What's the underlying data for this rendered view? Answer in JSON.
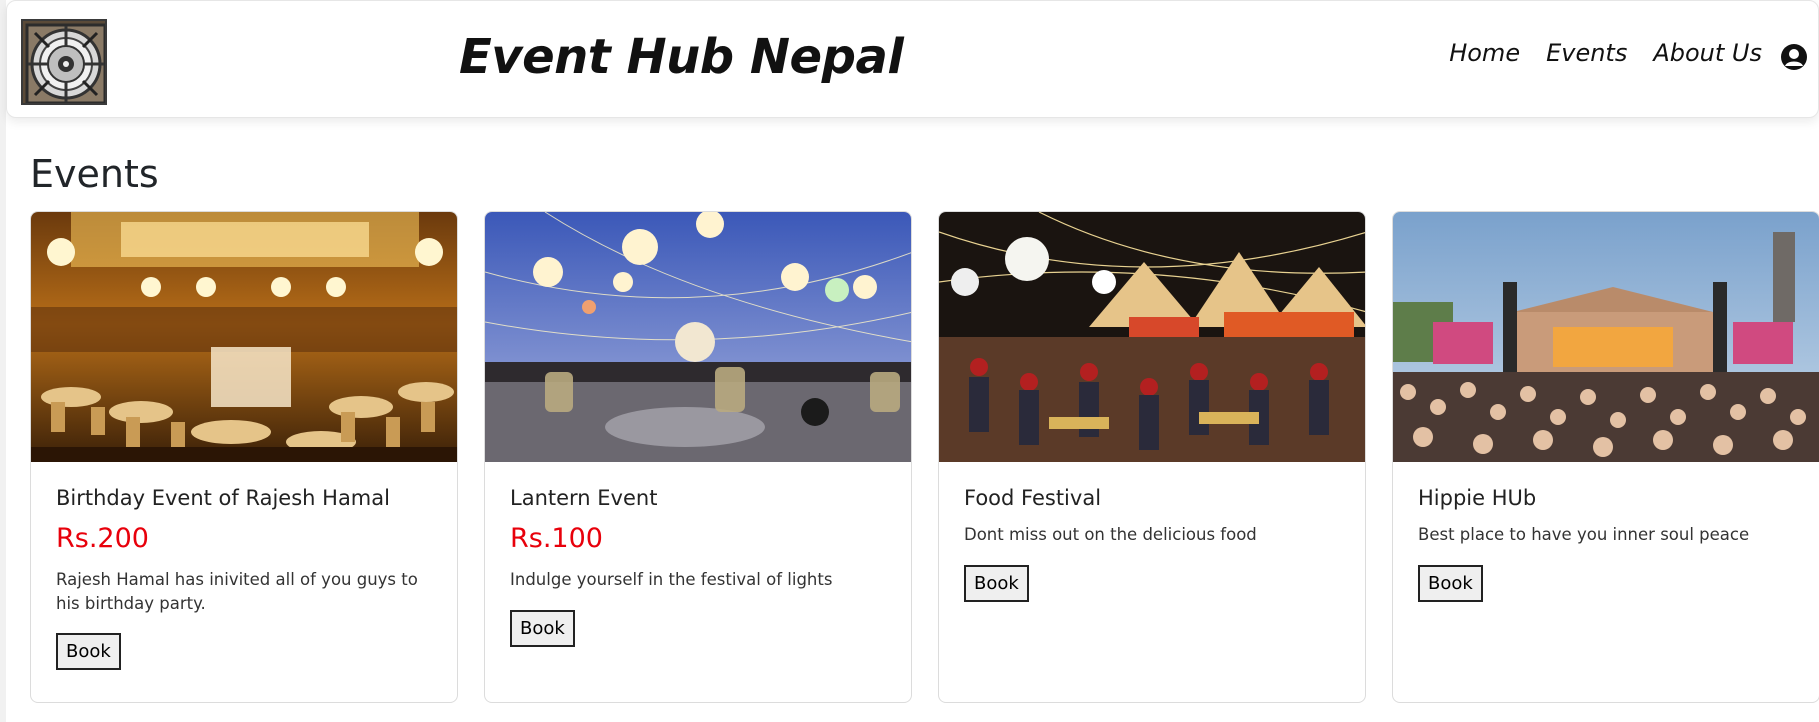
{
  "header": {
    "brand": "Event Hub Nepal",
    "nav": [
      {
        "label": "Home"
      },
      {
        "label": "Events"
      },
      {
        "label": "About Us"
      }
    ]
  },
  "main": {
    "section_title": "Events",
    "cards": [
      {
        "title": "Birthday Event of Rajesh Hamal",
        "price": "Rs.200",
        "description": "Rajesh Hamal has inivited all of you guys to his birthday party.",
        "button": "Book"
      },
      {
        "title": "Lantern Event",
        "price": "Rs.100",
        "description": "Indulge yourself in the festival of lights",
        "button": "Book"
      },
      {
        "title": "Food Festival",
        "description": "Dont miss out on the delicious food",
        "button": "Book"
      },
      {
        "title": "Hippie HUb",
        "description": "Best place to have you inner soul peace",
        "button": "Book"
      }
    ]
  },
  "colors": {
    "price": "#e8000b",
    "text": "#212529",
    "button_bg": "#efefef"
  },
  "icons": {
    "profile": "user-circle-icon",
    "logo": "mandala-logo"
  }
}
